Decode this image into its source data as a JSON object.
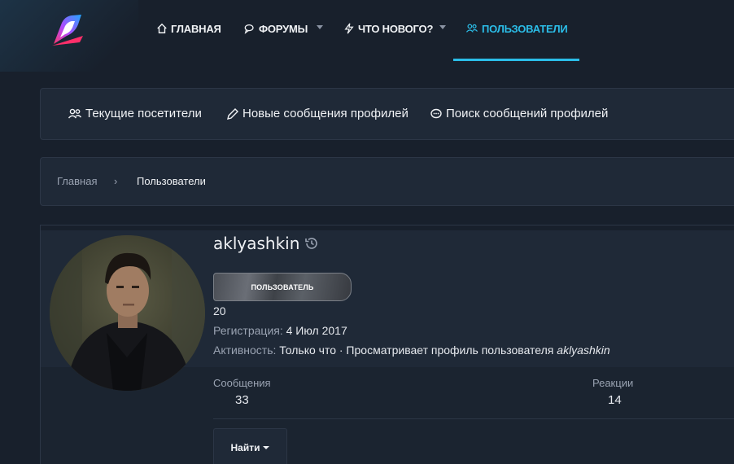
{
  "colors": {
    "accent": "#2bbde8",
    "panel": "#1f2937",
    "background": "#18202c"
  },
  "nav": {
    "home": "ГЛАВНАЯ",
    "forums": "ФОРУМЫ",
    "whats_new": "ЧТО НОВОГО?",
    "users": "ПОЛЬЗОВАТЕЛИ"
  },
  "subnav": {
    "current_visitors": "Текущие посетители",
    "new_profile_posts": "Новые сообщения профилей",
    "search_profile_posts": "Поиск сообщений профилей"
  },
  "breadcrumb": {
    "home": "Главная",
    "separator": "›",
    "current": "Пользователи"
  },
  "profile": {
    "username": "aklyashkin",
    "banner": "ПОЛЬЗОВАТЕЛЬ",
    "age": "20",
    "registered_label": "Регистрация:",
    "registered_value": "4 Июл 2017",
    "activity_label": "Активность:",
    "activity_value": "Только что · Просматривает профиль пользователя",
    "activity_user": "aklyashkin",
    "messages_label": "Сообщения",
    "messages_value": "33",
    "reactions_label": "Реакции",
    "reactions_value": "14",
    "find_button": "Найти"
  }
}
